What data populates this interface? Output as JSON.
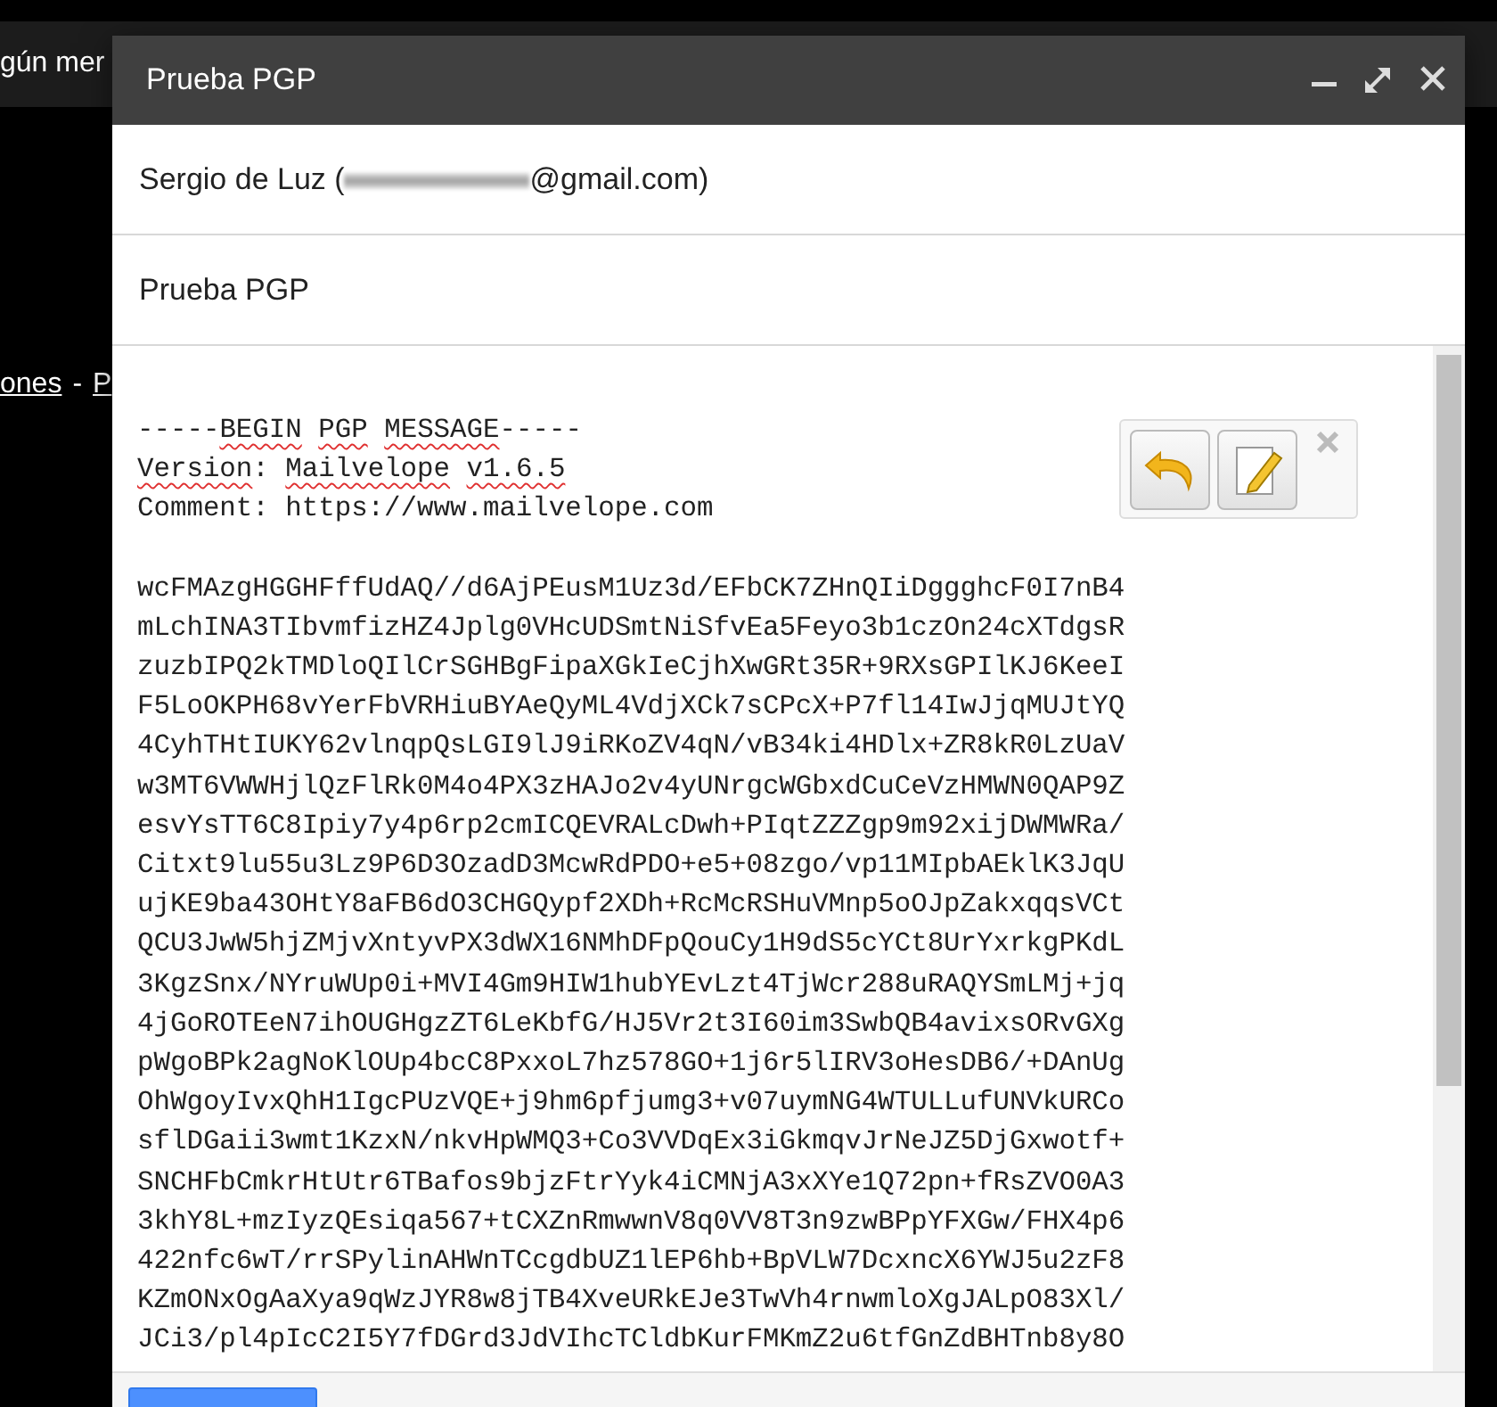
{
  "background": {
    "top_text": "gún mer",
    "links": [
      {
        "kind": "link",
        "text": "ones"
      },
      {
        "kind": "separator",
        "text": "-"
      },
      {
        "kind": "link",
        "text": "P"
      }
    ]
  },
  "window": {
    "title": "Prueba PGP",
    "controls": [
      {
        "kind": "minimize"
      },
      {
        "kind": "expand"
      },
      {
        "kind": "close"
      }
    ]
  },
  "recipient": {
    "name": "Sergio de Luz (",
    "address_end": "@gmail.com)",
    "redacted": true
  },
  "subject": "Prueba PGP",
  "message": {
    "header": [
      [
        {
          "text": "-----",
          "misspelled": false,
          "space_before": false
        },
        {
          "text": "BEGIN",
          "misspelled": true,
          "space_before": false
        },
        {
          "text": "PGP",
          "misspelled": true,
          "space_before": true
        },
        {
          "text": "MESSAGE",
          "misspelled": true,
          "space_before": true
        },
        {
          "text": "-----",
          "misspelled": false,
          "space_before": false
        }
      ],
      [
        {
          "text": "Version",
          "misspelled": true,
          "space_before": false
        },
        {
          "text": ":",
          "misspelled": false,
          "space_before": false
        },
        {
          "text": "Mailvelope",
          "misspelled": true,
          "space_before": true
        },
        {
          "text": "v1.6.5",
          "misspelled": true,
          "space_before": true
        }
      ],
      [
        {
          "text": "Comment: https://www.mailvelope.com",
          "misspelled": false,
          "space_before": false
        }
      ]
    ],
    "body": [
      "wcFMAzgHGGHFffUdAQ//d6AjPEusM1Uz3d/EFbCK7ZHnQIiDggghcF0I7nB4",
      "mLchINA3TIbvmfizHZ4Jplg0VHcUDSmtNiSfvEa5Feyo3b1czOn24cXTdgsR",
      "zuzbIPQ2kTMDloQIlCrSGHBgFipaXGkIeCjhXwGRt35R+9RXsGPIlKJ6KeeI",
      "F5LoOKPH68vYerFbVRHiuBYAeQyML4VdjXCk7sCPcX+P7fl14IwJjqMUJtYQ",
      "4CyhTHtIUKY62vlnqpQsLGI9lJ9iRKoZV4qN/vB34ki4HDlx+ZR8kR0LzUaV",
      "w3MT6VWWHjlQzFlRk0M4o4PX3zHAJo2v4yUNrgcWGbxdCuCeVzHMWN0QAP9Z",
      "esvYsTT6C8Ipiy7y4p6rp2cmICQEVRALcDwh+PIqtZZZgp9m92xijDWMWRa/",
      "Citxt9lu55u3Lz9P6D3OzadD3McwRdPDO+e5+08zgo/vp11MIpbAEklK3JqU",
      "ujKE9ba43OHtY8aFB6dO3CHGQypf2XDh+RcMcRSHuVMnp5oOJpZakxqqsVCt",
      "QCU3JwW5hjZMjvXntyvPX3dWX16NMhDFpQouCy1H9dS5cYCt8UrYxrkgPKdL",
      "3KgzSnx/NYruWUp0i+MVI4Gm9HIW1hubYEvLzt4TjWcr288uRAQYSmLMj+jq",
      "4jGoROTEeN7ihOUGHgzZT6LeKbfG/HJ5Vr2t3I60im3SwbQB4avixsORvGXg",
      "pWgoBPk2agNoKlOUp4bcC8PxxoL7hz578GO+1j6r5lIRV3oHesDB6/+DAnUg",
      "OhWgoyIvxQhH1IgcPUzVQE+j9hm6pfjumg3+v07uymNG4WTULLufUNVkURCo",
      "sflDGaii3wmt1KzxN/nkvHpWMQ3+Co3VVDqEx3iGkmqvJrNeJZ5DjGxwotf+",
      "SNCHFbCmkrHtUtr6TBafos9bjzFtrYyk4iCMNjA3xXYe1Q72pn+fRsZVO0A3",
      "3khY8L+mzIyzQEsiqa567+tCXZnRmwwnV8q0VV8T3n9zwBPpYFXGw/FHX4p6",
      "422nfc6wT/rrSPylinAHWnTCcgdbUZ1lEP6hb+BpVLW7DcxncX6YWJ5u2zF8",
      "KZmONxOgAaXya9qWzJYR8w8jTB4XveURkEJe3TwVh4rnwmloXgJALpO83Xl/",
      "JCi3/pl4pIcC2I5Y7fDGrd3JdVIhcTCldbKurFMKmZ2u6tfGnZdBHTnb8y8O"
    ]
  },
  "overlay_tools": [
    {
      "kind": "undo"
    },
    {
      "kind": "edit"
    },
    {
      "kind": "close"
    }
  ],
  "footer": {
    "send_button": true
  }
}
